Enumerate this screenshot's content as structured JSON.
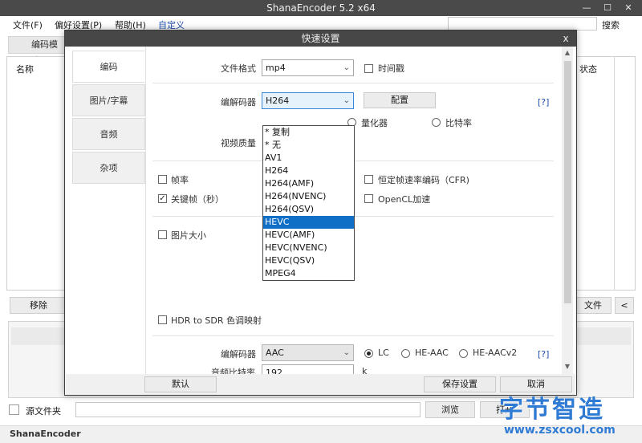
{
  "window": {
    "title": "ShanaEncoder 5.2 x64",
    "controls": [
      "—",
      "☐",
      "✕"
    ]
  },
  "menu": {
    "items": [
      "文件(F)",
      "偏好设置(P)",
      "帮助(H)",
      "自定义"
    ],
    "search_label": "搜索"
  },
  "background": {
    "tab_label": "编码模式",
    "col_name": "名称",
    "col_status": "状态",
    "remove_button": "移除",
    "file_button": "文件",
    "collapse_button": "<",
    "source_folder_label": "源文件夹",
    "browse_button": "浏览",
    "open_button": "打开",
    "status_text": "ShanaEncoder"
  },
  "dialog": {
    "title": "快速设置",
    "close": "x",
    "tabs": [
      "编码",
      "图片/字幕",
      "音频",
      "杂项"
    ],
    "file_format_label": "文件格式",
    "file_format_value": "mp4",
    "timestamp_label": "时间戳",
    "video_codec_label": "编解码器",
    "video_codec_value": "H264",
    "config_button": "配置",
    "help_link": "[?]",
    "quantizer_label": "量化器",
    "bitrate_label": "比特率",
    "video_quality_label": "视频质量",
    "framerate_label": "帧率",
    "cfr_label": "恒定帧速率编码（CFR)",
    "keyframe_label": "关键帧（秒）",
    "opencl_label": "OpenCL加速",
    "image_size_label": "图片大小",
    "hdr_label": "HDR to SDR 色调映射",
    "audio_codec_label": "编解码器",
    "audio_codec_value": "AAC",
    "aac_options": [
      "LC",
      "HE-AAC",
      "HE-AACv2"
    ],
    "audio_help_link": "[?]",
    "audio_bitrate_label": "音频比特率",
    "audio_bitrate_value": "192",
    "audio_bitrate_unit": "k",
    "codec_options": [
      "* 复制",
      "* 无",
      "AV1",
      "H264",
      "H264(AMF)",
      "H264(NVENC)",
      "H264(QSV)",
      "HEVC",
      "HEVC(AMF)",
      "HEVC(NVENC)",
      "HEVC(QSV)",
      "MPEG4"
    ],
    "codec_selected_index": 7,
    "footer": {
      "default_button": "默认",
      "save_button": "保存设置",
      "cancel_button": "取消"
    }
  },
  "watermark": {
    "big": "字节智造",
    "small": "www.zsxcool.com"
  },
  "colors": {
    "titlebar": "#4a4a4a",
    "accent": "#1f4fb0",
    "selection": "#0f6fc6"
  }
}
